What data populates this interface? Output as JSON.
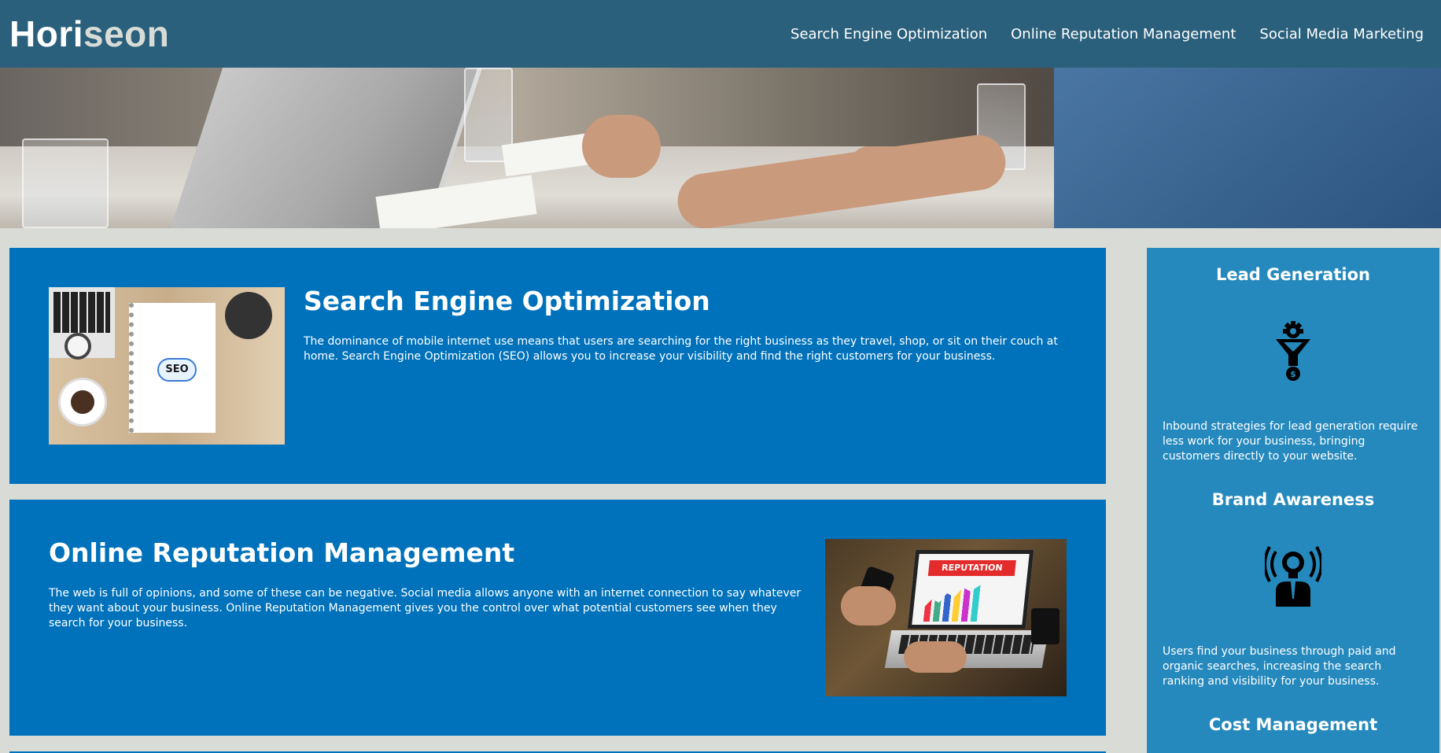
{
  "header": {
    "logo_part1": "Hori",
    "logo_part2": "seon",
    "nav": [
      {
        "label": "Search Engine Optimization"
      },
      {
        "label": "Online Reputation Management"
      },
      {
        "label": "Social Media Marketing"
      }
    ]
  },
  "hero": {
    "image": "business-meeting-hands-on-table"
  },
  "main": {
    "seo": {
      "title": "Search Engine Optimization",
      "text": "The dominance of mobile internet use means that users are searching for the right business as they travel, shop, or sit on their couch at home. Search Engine Optimization (SEO) allows you to increase your visibility and find the right customers for your business.",
      "image": "seo-notebook-on-desk",
      "image_label": "SEO"
    },
    "orm": {
      "title": "Online Reputation Management",
      "text": "The web is full of opinions, and some of these can be negative. Social media allows anyone with an internet connection to say whatever they want about your business. Online Reputation Management gives you the control over what potential customers see when they search for your business.",
      "image": "laptop-reputation-chart",
      "image_label": "REPUTATION"
    }
  },
  "sidebar": {
    "lead": {
      "title": "Lead Generation",
      "icon": "funnel-gear-icon",
      "text": "Inbound strategies for lead generation require less work for your business, bringing customers directly to your website."
    },
    "brand": {
      "title": "Brand Awareness",
      "icon": "lightbulb-person-icon",
      "text": "Users find your business through paid and organic searches, increasing the search ranking and visibility for your business."
    },
    "cost": {
      "title": "Cost Management"
    }
  },
  "colors": {
    "header_bg": "#2a607c",
    "card_bg": "#0072bb",
    "sidebar_bg": "#2589bd",
    "page_bg": "#d9dcd6",
    "logo_accent": "#d9dcd6"
  }
}
